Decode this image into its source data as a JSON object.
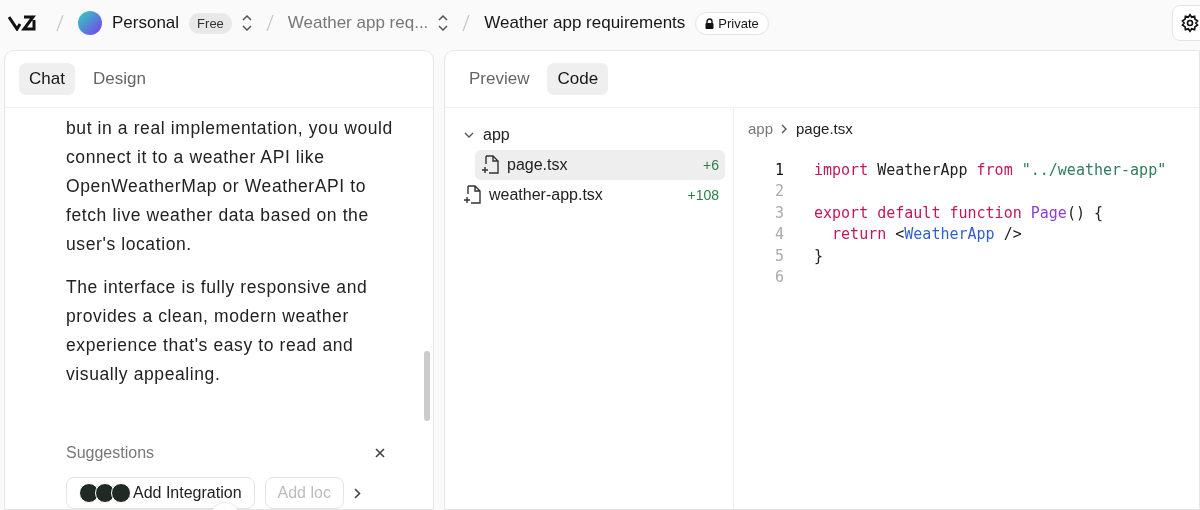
{
  "topbar": {
    "team": "Personal",
    "plan": "Free",
    "project": "Weather app req...",
    "chat_title": "Weather app requirements",
    "visibility": "Private"
  },
  "left_tabs": [
    {
      "label": "Chat",
      "selected": true
    },
    {
      "label": "Design",
      "selected": false
    }
  ],
  "messages": [
    "but in a real implementation, you would connect it to a weather API like OpenWeatherMap or WeatherAPI to fetch live weather data based on the user's location.",
    "The interface is fully responsive and provides a clean, modern weather experience that's easy to read and visually appealing."
  ],
  "suggestions": {
    "title": "Suggestions",
    "chips": [
      {
        "label": "Add Integration",
        "kind": "integration"
      },
      {
        "label": "Add loc",
        "kind": "faded"
      }
    ]
  },
  "right_tabs": [
    {
      "label": "Preview",
      "selected": false
    },
    {
      "label": "Code",
      "selected": true
    }
  ],
  "file_tree": [
    {
      "name": "app",
      "kind": "folder",
      "expanded": true,
      "children": [
        {
          "name": "page.tsx",
          "kind": "file",
          "added": "+6",
          "selected": true
        }
      ]
    },
    {
      "name": "weather-app.tsx",
      "kind": "file",
      "added": "+108",
      "selected": false
    }
  ],
  "breadcrumb": [
    "app",
    "page.tsx"
  ],
  "code_lines": [
    {
      "number": "1",
      "active": true,
      "tokens": [
        {
          "text": "import",
          "kind": "keyword"
        },
        {
          "text": " WeatherApp ",
          "kind": "plain"
        },
        {
          "text": "from",
          "kind": "keyword"
        },
        {
          "text": " \"../weather-app\"",
          "kind": "string"
        }
      ]
    },
    {
      "number": "2",
      "active": false
    },
    {
      "number": "3",
      "active": false,
      "tokens": [
        {
          "text": "export default function",
          "kind": "keyword"
        },
        {
          "text": " Page",
          "kind": "function"
        },
        {
          "text": "() {",
          "kind": "plain"
        }
      ]
    },
    {
      "number": "4",
      "active": false,
      "tokens": [
        {
          "text": "  return",
          "kind": "keyword"
        },
        {
          "text": " <",
          "kind": "plain"
        },
        {
          "text": "WeatherApp",
          "kind": "tag"
        },
        {
          "text": " />",
          "kind": "plain"
        }
      ]
    },
    {
      "number": "5",
      "active": false,
      "tokens": [
        {
          "text": "}",
          "kind": "plain"
        }
      ]
    },
    {
      "number": "6",
      "active": false
    }
  ]
}
